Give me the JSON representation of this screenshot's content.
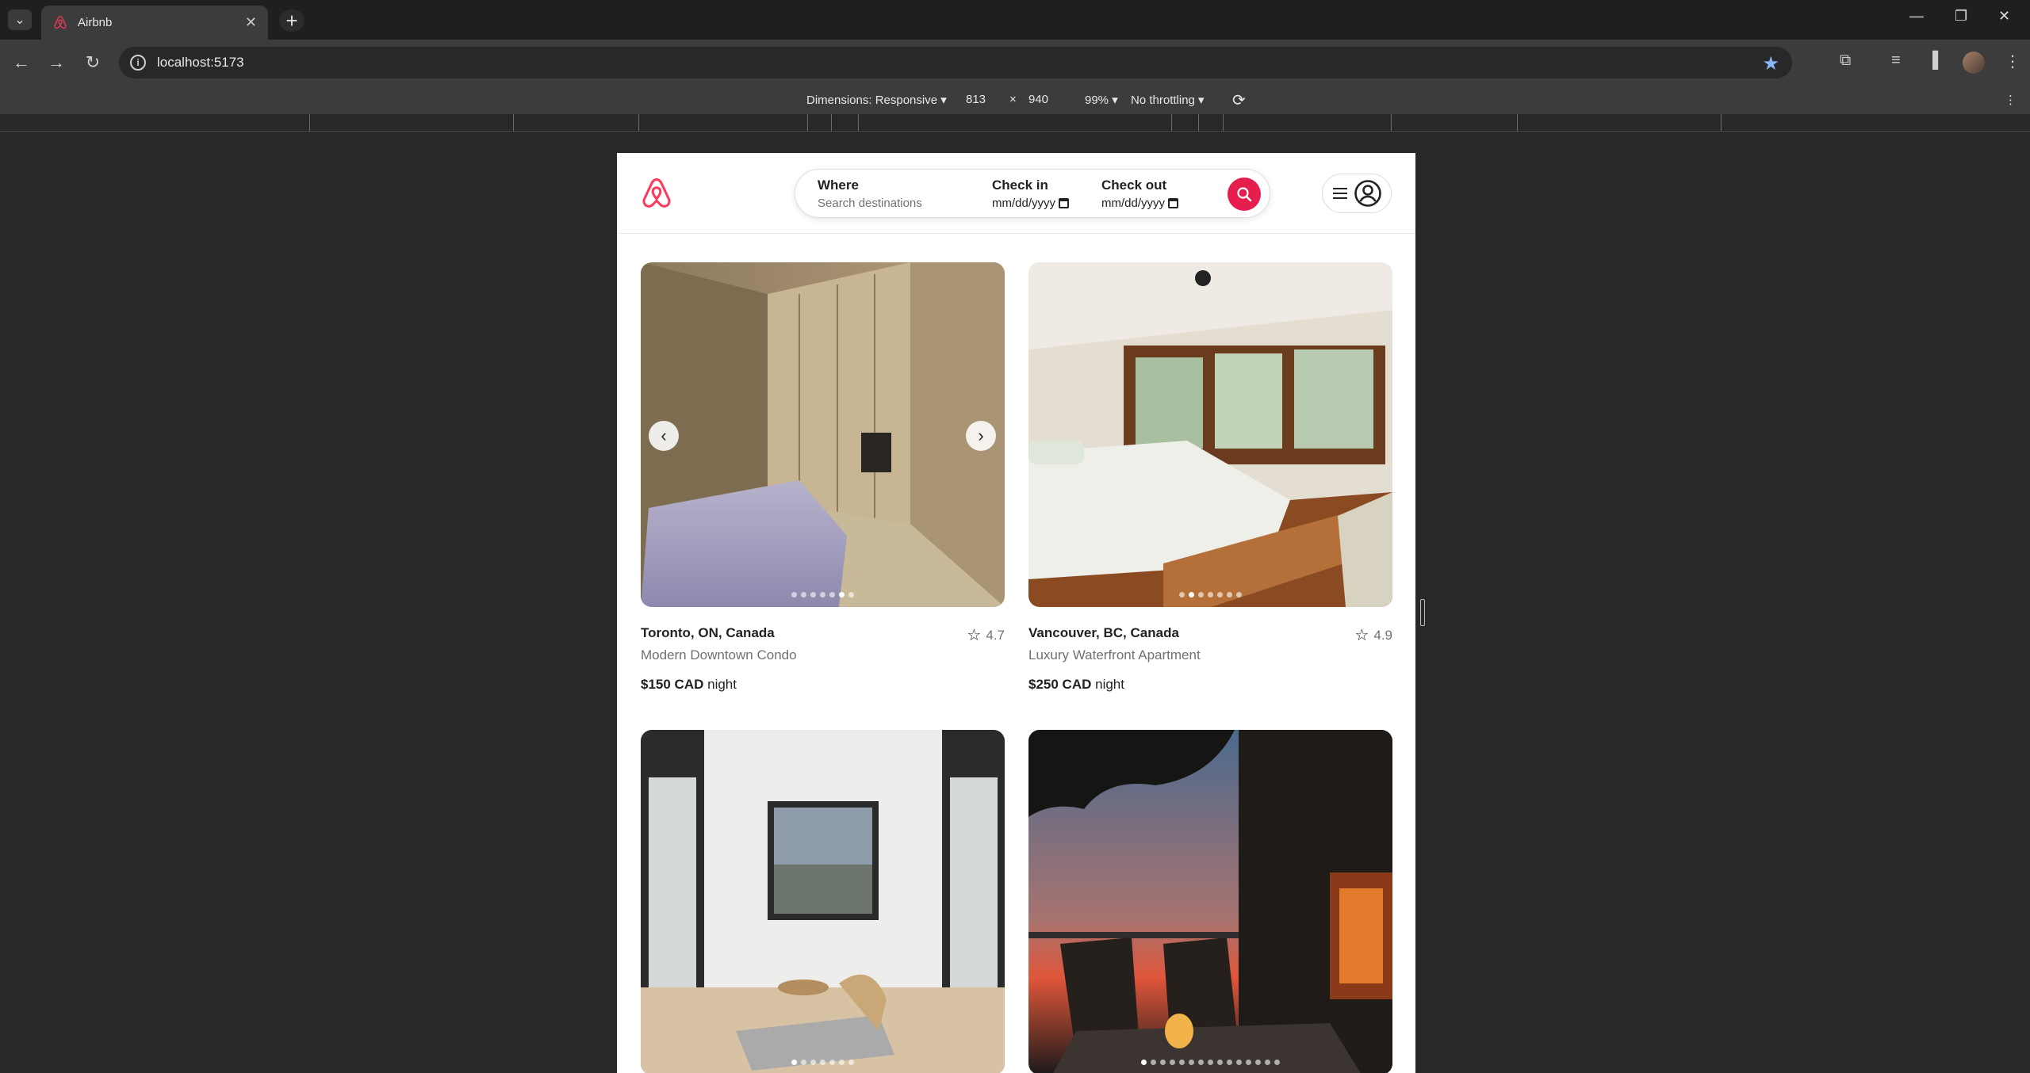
{
  "browser": {
    "tab_title": "Airbnb",
    "url": "localhost:5173",
    "new_tab_symbol": "+",
    "close_symbol": "✕"
  },
  "devtools": {
    "dimensions_label": "Dimensions: Responsive ▾",
    "width": "813",
    "times": "×",
    "height": "940",
    "zoom": "99% ▾",
    "throttling": "No throttling ▾"
  },
  "header": {
    "where_label": "Where",
    "where_placeholder": "Search destinations",
    "checkin_label": "Check in",
    "checkin_value": "mm/dd/yyyy",
    "checkout_label": "Check out",
    "checkout_value": "mm/dd/yyyy"
  },
  "listings": [
    {
      "location": "Toronto, ON, Canada",
      "rating": "4.7",
      "title": "Modern Downtown Condo",
      "price": "$150 CAD",
      "unit": "night",
      "dots": 7,
      "active_dot": 5
    },
    {
      "location": "Vancouver, BC, Canada",
      "rating": "4.9",
      "title": "Luxury Waterfront Apartment",
      "price": "$250 CAD",
      "unit": "night",
      "dots": 7,
      "active_dot": 1
    },
    {
      "dots": 7,
      "active_dot": 0
    },
    {
      "dots": 15,
      "active_dot": 0
    }
  ],
  "colors": {
    "brand": "#ff385c",
    "search_button": "#e61e4d"
  }
}
